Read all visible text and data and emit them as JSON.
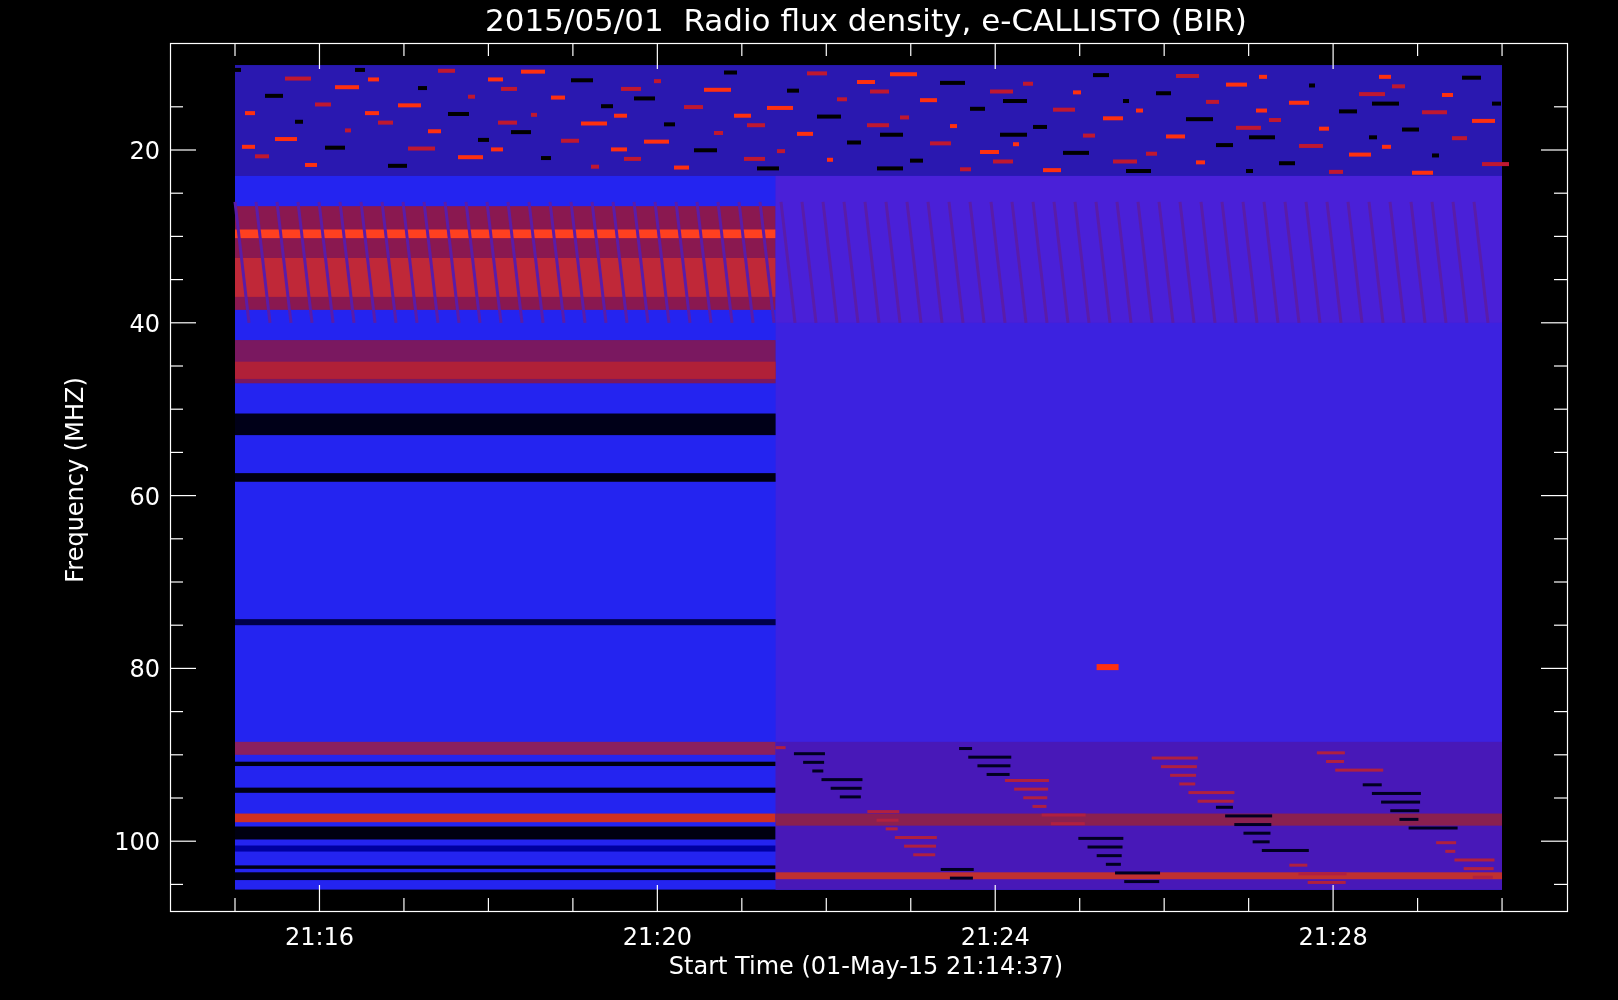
{
  "title": "2015/05/01  Radio flux density, e-CALLISTO (BIR)",
  "y_axis": {
    "label": "Frequency (MHZ)",
    "ticks": [
      "20",
      "40",
      "60",
      "80",
      "100"
    ]
  },
  "x_axis": {
    "label": "Start Time (01-May-15 21:14:37)",
    "ticks": [
      "21:16",
      "21:20",
      "21:24",
      "21:28"
    ]
  }
}
